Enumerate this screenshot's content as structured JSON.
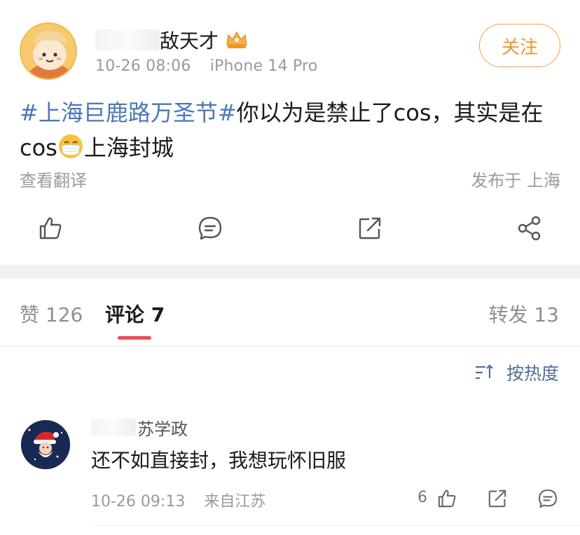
{
  "post": {
    "username": "敌天才",
    "time": "10-26 08:06",
    "device": "iPhone 14 Pro",
    "follow_label": "关注",
    "topic": "#上海巨鹿路万圣节#",
    "text_part1": "你以为是禁止了cos，其实是在cos",
    "text_part2": "上海封城",
    "translate_label": "查看翻译",
    "location": "发布于 上海"
  },
  "actions": {
    "icons": [
      "like-icon",
      "comment-icon",
      "repost-icon",
      "share-icon"
    ]
  },
  "tabs": {
    "likes": "赞 126",
    "comments": "评论 7",
    "reposts": "转发 13"
  },
  "sort": {
    "label": "按热度"
  },
  "comment": {
    "username": "苏学政",
    "text": "还不如直接封，我想玩怀旧服",
    "time": "10-26 09:13",
    "from": "来自江苏",
    "like_count": "6"
  },
  "colors": {
    "topic": "#4a77b8",
    "follow": "#f0952d",
    "tab_underline": "#ec4a5a",
    "sort": "#4f6f95"
  }
}
